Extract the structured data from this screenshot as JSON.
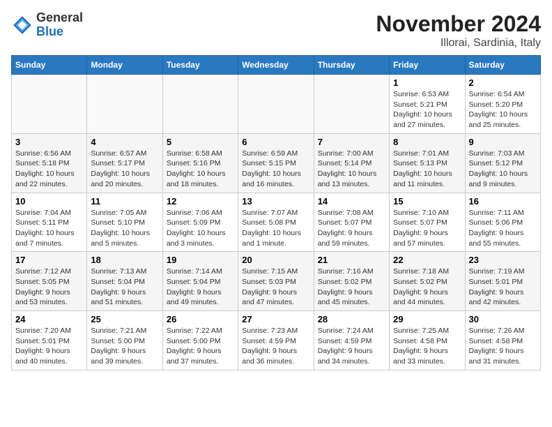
{
  "header": {
    "logo_line1": "General",
    "logo_line2": "Blue",
    "month_title": "November 2024",
    "location": "Illorai, Sardinia, Italy"
  },
  "weekdays": [
    "Sunday",
    "Monday",
    "Tuesday",
    "Wednesday",
    "Thursday",
    "Friday",
    "Saturday"
  ],
  "weeks": [
    [
      {
        "day": "",
        "info": ""
      },
      {
        "day": "",
        "info": ""
      },
      {
        "day": "",
        "info": ""
      },
      {
        "day": "",
        "info": ""
      },
      {
        "day": "",
        "info": ""
      },
      {
        "day": "1",
        "info": "Sunrise: 6:53 AM\nSunset: 5:21 PM\nDaylight: 10 hours and 27 minutes."
      },
      {
        "day": "2",
        "info": "Sunrise: 6:54 AM\nSunset: 5:20 PM\nDaylight: 10 hours and 25 minutes."
      }
    ],
    [
      {
        "day": "3",
        "info": "Sunrise: 6:56 AM\nSunset: 5:18 PM\nDaylight: 10 hours and 22 minutes."
      },
      {
        "day": "4",
        "info": "Sunrise: 6:57 AM\nSunset: 5:17 PM\nDaylight: 10 hours and 20 minutes."
      },
      {
        "day": "5",
        "info": "Sunrise: 6:58 AM\nSunset: 5:16 PM\nDaylight: 10 hours and 18 minutes."
      },
      {
        "day": "6",
        "info": "Sunrise: 6:59 AM\nSunset: 5:15 PM\nDaylight: 10 hours and 16 minutes."
      },
      {
        "day": "7",
        "info": "Sunrise: 7:00 AM\nSunset: 5:14 PM\nDaylight: 10 hours and 13 minutes."
      },
      {
        "day": "8",
        "info": "Sunrise: 7:01 AM\nSunset: 5:13 PM\nDaylight: 10 hours and 11 minutes."
      },
      {
        "day": "9",
        "info": "Sunrise: 7:03 AM\nSunset: 5:12 PM\nDaylight: 10 hours and 9 minutes."
      }
    ],
    [
      {
        "day": "10",
        "info": "Sunrise: 7:04 AM\nSunset: 5:11 PM\nDaylight: 10 hours and 7 minutes."
      },
      {
        "day": "11",
        "info": "Sunrise: 7:05 AM\nSunset: 5:10 PM\nDaylight: 10 hours and 5 minutes."
      },
      {
        "day": "12",
        "info": "Sunrise: 7:06 AM\nSunset: 5:09 PM\nDaylight: 10 hours and 3 minutes."
      },
      {
        "day": "13",
        "info": "Sunrise: 7:07 AM\nSunset: 5:08 PM\nDaylight: 10 hours and 1 minute."
      },
      {
        "day": "14",
        "info": "Sunrise: 7:08 AM\nSunset: 5:07 PM\nDaylight: 9 hours and 59 minutes."
      },
      {
        "day": "15",
        "info": "Sunrise: 7:10 AM\nSunset: 5:07 PM\nDaylight: 9 hours and 57 minutes."
      },
      {
        "day": "16",
        "info": "Sunrise: 7:11 AM\nSunset: 5:06 PM\nDaylight: 9 hours and 55 minutes."
      }
    ],
    [
      {
        "day": "17",
        "info": "Sunrise: 7:12 AM\nSunset: 5:05 PM\nDaylight: 9 hours and 53 minutes."
      },
      {
        "day": "18",
        "info": "Sunrise: 7:13 AM\nSunset: 5:04 PM\nDaylight: 9 hours and 51 minutes."
      },
      {
        "day": "19",
        "info": "Sunrise: 7:14 AM\nSunset: 5:04 PM\nDaylight: 9 hours and 49 minutes."
      },
      {
        "day": "20",
        "info": "Sunrise: 7:15 AM\nSunset: 5:03 PM\nDaylight: 9 hours and 47 minutes."
      },
      {
        "day": "21",
        "info": "Sunrise: 7:16 AM\nSunset: 5:02 PM\nDaylight: 9 hours and 45 minutes."
      },
      {
        "day": "22",
        "info": "Sunrise: 7:18 AM\nSunset: 5:02 PM\nDaylight: 9 hours and 44 minutes."
      },
      {
        "day": "23",
        "info": "Sunrise: 7:19 AM\nSunset: 5:01 PM\nDaylight: 9 hours and 42 minutes."
      }
    ],
    [
      {
        "day": "24",
        "info": "Sunrise: 7:20 AM\nSunset: 5:01 PM\nDaylight: 9 hours and 40 minutes."
      },
      {
        "day": "25",
        "info": "Sunrise: 7:21 AM\nSunset: 5:00 PM\nDaylight: 9 hours and 39 minutes."
      },
      {
        "day": "26",
        "info": "Sunrise: 7:22 AM\nSunset: 5:00 PM\nDaylight: 9 hours and 37 minutes."
      },
      {
        "day": "27",
        "info": "Sunrise: 7:23 AM\nSunset: 4:59 PM\nDaylight: 9 hours and 36 minutes."
      },
      {
        "day": "28",
        "info": "Sunrise: 7:24 AM\nSunset: 4:59 PM\nDaylight: 9 hours and 34 minutes."
      },
      {
        "day": "29",
        "info": "Sunrise: 7:25 AM\nSunset: 4:58 PM\nDaylight: 9 hours and 33 minutes."
      },
      {
        "day": "30",
        "info": "Sunrise: 7:26 AM\nSunset: 4:58 PM\nDaylight: 9 hours and 31 minutes."
      }
    ]
  ]
}
